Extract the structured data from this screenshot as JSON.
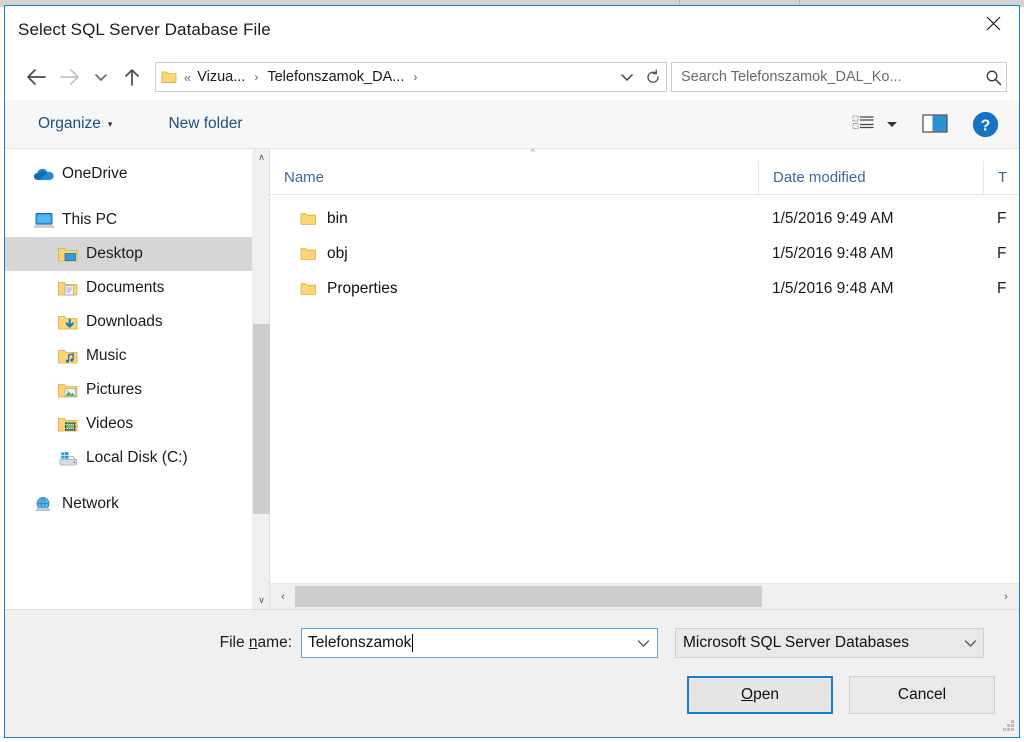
{
  "window": {
    "title": "Select SQL Server Database File",
    "close_label": "✕"
  },
  "navbar": {
    "back_tooltip": "Back",
    "forward_tooltip": "Forward",
    "recent_tooltip": "Recent locations",
    "up_tooltip": "Up",
    "breadcrumb": {
      "overflow": "«",
      "items": [
        "Vizua...",
        "Telefonszamok_DA..."
      ],
      "separator": "›"
    },
    "address_dropdown": "⌄",
    "refresh": "↻",
    "search": {
      "placeholder": "Search Telefonszamok_DAL_Ko...",
      "icon": "search-icon"
    }
  },
  "commandbar": {
    "organize_label": "Organize",
    "organize_caret": "▾",
    "new_folder_label": "New folder",
    "view_icon": "view-list-icon",
    "view_caret": "▾",
    "preview_pane_icon": "preview-pane-icon",
    "help_label": "?"
  },
  "navpane": {
    "items": [
      {
        "label": "OneDrive",
        "icon": "onedrive-cloud-icon",
        "indent": false,
        "selected": false,
        "gap_before": false
      },
      {
        "label": "This PC",
        "icon": "this-pc-icon",
        "indent": false,
        "selected": false,
        "gap_before": true
      },
      {
        "label": "Desktop",
        "icon": "desktop-folder-icon",
        "indent": true,
        "selected": true,
        "gap_before": false
      },
      {
        "label": "Documents",
        "icon": "documents-folder-icon",
        "indent": true,
        "selected": false,
        "gap_before": false
      },
      {
        "label": "Downloads",
        "icon": "downloads-folder-icon",
        "indent": true,
        "selected": false,
        "gap_before": false
      },
      {
        "label": "Music",
        "icon": "music-folder-icon",
        "indent": true,
        "selected": false,
        "gap_before": false
      },
      {
        "label": "Pictures",
        "icon": "pictures-folder-icon",
        "indent": true,
        "selected": false,
        "gap_before": false
      },
      {
        "label": "Videos",
        "icon": "videos-folder-icon",
        "indent": true,
        "selected": false,
        "gap_before": false
      },
      {
        "label": "Local Disk (C:)",
        "icon": "local-disk-icon",
        "indent": true,
        "selected": false,
        "gap_before": false
      },
      {
        "label": "Network",
        "icon": "network-icon",
        "indent": false,
        "selected": false,
        "gap_before": true
      }
    ],
    "scroll_up": "∧",
    "scroll_down": "∨"
  },
  "filelist": {
    "sort_indicator": "⌃",
    "columns": [
      {
        "label": "Name",
        "key": "name"
      },
      {
        "label": "Date modified",
        "key": "date"
      },
      {
        "label": "T",
        "key": "type"
      }
    ],
    "rows": [
      {
        "name": "bin",
        "date": "1/5/2016 9:49 AM",
        "type": "F",
        "icon": "folder-icon"
      },
      {
        "name": "obj",
        "date": "1/5/2016 9:48 AM",
        "type": "F",
        "icon": "folder-icon"
      },
      {
        "name": "Properties",
        "date": "1/5/2016 9:48 AM",
        "type": "F",
        "icon": "folder-icon"
      }
    ],
    "hscroll_left": "‹",
    "hscroll_right": "›"
  },
  "footer": {
    "filename_label_prefix": "File ",
    "filename_label_accel": "n",
    "filename_label_suffix": "ame:",
    "filename_value": "Telefonszamok",
    "filename_dropdown": "⌄",
    "filetype_value": "Microsoft SQL Server Databases",
    "filetype_dropdown": "⌄",
    "open_accel": "O",
    "open_rest": "pen",
    "cancel_label": "Cancel"
  },
  "colors": {
    "accent": "#1a7ec8",
    "link": "#1c4f82",
    "selection": "#d6d6d6",
    "folder": "#ffd153"
  }
}
